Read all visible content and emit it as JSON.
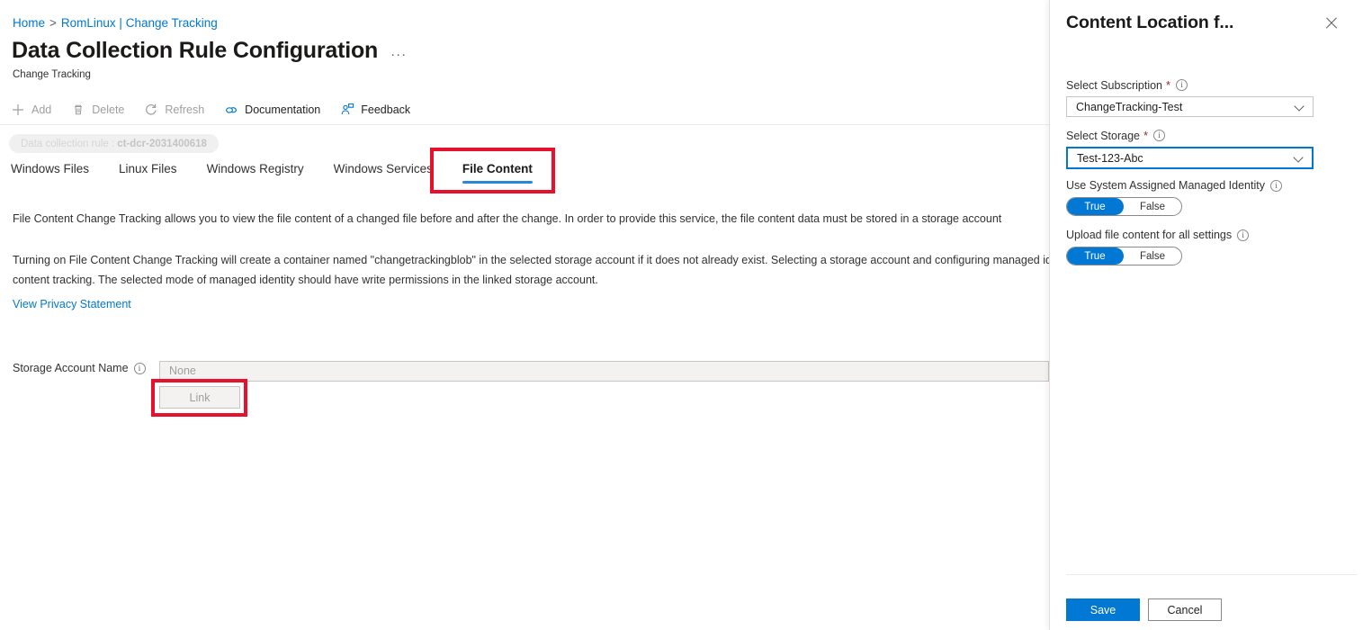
{
  "breadcrumb": {
    "home": "Home",
    "separator": ">",
    "current": "RomLinux | Change Tracking"
  },
  "header": {
    "title": "Data Collection Rule Configuration",
    "ellipsis": "···",
    "subtitle": "Change Tracking"
  },
  "toolbar": {
    "items": [
      {
        "label": "Add",
        "icon": "plus-icon",
        "enabled": false
      },
      {
        "label": "Delete",
        "icon": "trash-icon",
        "enabled": false
      },
      {
        "label": "Refresh",
        "icon": "refresh-icon",
        "enabled": false
      },
      {
        "label": "Documentation",
        "icon": "documentation-icon",
        "enabled": true
      },
      {
        "label": "Feedback",
        "icon": "feedback-icon",
        "enabled": true
      }
    ]
  },
  "chip": {
    "prefix": "Data collection rule : ",
    "value": "ct-dcr-2031400618"
  },
  "tabs": [
    {
      "label": "Windows Files",
      "active": false
    },
    {
      "label": "Linux Files",
      "active": false
    },
    {
      "label": "Windows Registry",
      "active": false
    },
    {
      "label": "Windows Services",
      "active": false
    },
    {
      "label": "File Content",
      "active": true
    }
  ],
  "content": {
    "paragraph1": "File Content Change Tracking allows you to view the file content of a changed file before and after the change. In order to provide this service, the file content data must be stored in a storage account",
    "paragraph2": "Turning on File Content Change Tracking will create a container named \"changetrackingblob\" in the selected storage account if it does not already exist. Selecting a storage account and configuring managed identity is required for file content tracking. The selected mode of managed identity should have write permissions in the linked storage account.",
    "privacy_link": "View Privacy Statement",
    "storage_label": "Storage Account Name",
    "storage_value": "None",
    "storage_placeholder": "None",
    "link_button": "Link"
  },
  "panel": {
    "title": "Content Location f...",
    "close_icon": "close-icon",
    "subscription": {
      "label": "Select Subscription",
      "required": "*",
      "value": "ChangeTracking-Test"
    },
    "storage": {
      "label": "Select Storage",
      "required": "*",
      "value": "Test-123-Abc"
    },
    "managed_identity": {
      "label": "Use System Assigned Managed Identity",
      "on_label": "True",
      "off_label": "False",
      "value": "True"
    },
    "upload_all": {
      "label": "Upload file content for all settings",
      "on_label": "True",
      "off_label": "False",
      "value": "True"
    },
    "save_button": "Save",
    "cancel_button": "Cancel"
  },
  "colors": {
    "accent": "#0078d4",
    "tab_underline": "#2b88d8",
    "link": "#0078d4",
    "annotation": "#e8112d",
    "required": "#a4262c"
  }
}
